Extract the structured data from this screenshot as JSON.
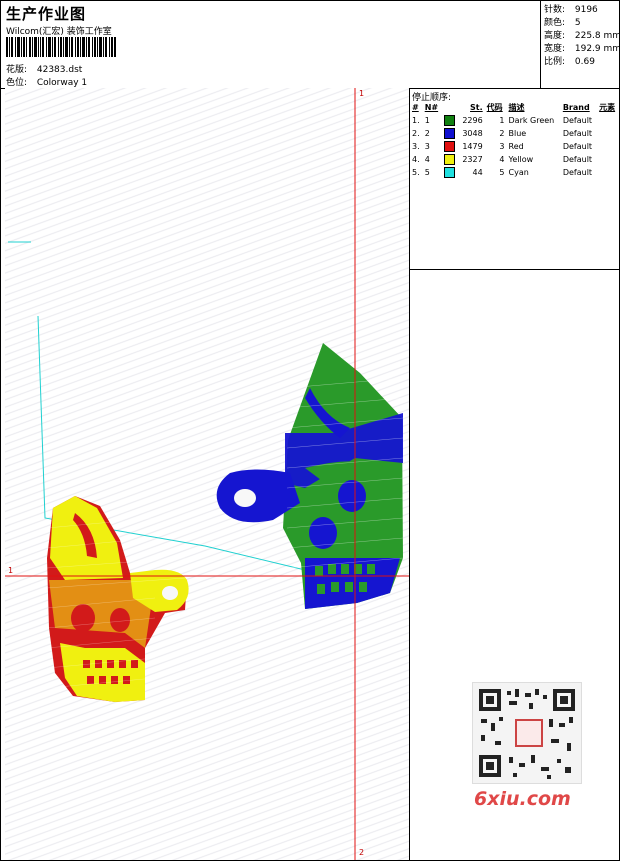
{
  "header": {
    "title": "生产作业图",
    "subtitle": "Wilcom(汇宏) 装饰工作室",
    "design_label": "花版:",
    "design_value": "42383.dst",
    "colorway_label": "色位:",
    "colorway_value": "Colorway 1"
  },
  "stats": {
    "stitches_label": "针数:",
    "stitches_value": "9196",
    "colors_label": "颜色:",
    "colors_value": "5",
    "height_label": "高度:",
    "height_value": "225.8 mm",
    "width_label": "宽度:",
    "width_value": "192.9 mm",
    "ratio_label": "比例:",
    "ratio_value": "0.69"
  },
  "axes": {
    "top_label": "1",
    "left_label": "1",
    "bottom_label": "2"
  },
  "color_table": {
    "title": "停止顺序:",
    "headers": {
      "index": "#",
      "needle": "N#",
      "stitches": "St.",
      "code": "代码",
      "desc": "描述",
      "brand": "Brand",
      "element": "元素"
    },
    "rows": [
      {
        "index": "1.",
        "needle": "1",
        "color": "#108010",
        "stitches": "2296",
        "code": "1",
        "desc": "Dark Green",
        "brand": "Default"
      },
      {
        "index": "2.",
        "needle": "2",
        "color": "#1010d0",
        "stitches": "3048",
        "code": "2",
        "desc": "Blue",
        "brand": "Default"
      },
      {
        "index": "3.",
        "needle": "3",
        "color": "#e01010",
        "stitches": "1479",
        "code": "3",
        "desc": "Red",
        "brand": "Default"
      },
      {
        "index": "4.",
        "needle": "4",
        "color": "#f0f010",
        "stitches": "2327",
        "code": "4",
        "desc": "Yellow",
        "brand": "Default"
      },
      {
        "index": "5.",
        "needle": "5",
        "color": "#20e0e0",
        "stitches": "44",
        "code": "5",
        "desc": "Cyan",
        "brand": "Default"
      }
    ]
  },
  "watermark": {
    "text": "6xiu.com",
    "stamp": "印章"
  }
}
